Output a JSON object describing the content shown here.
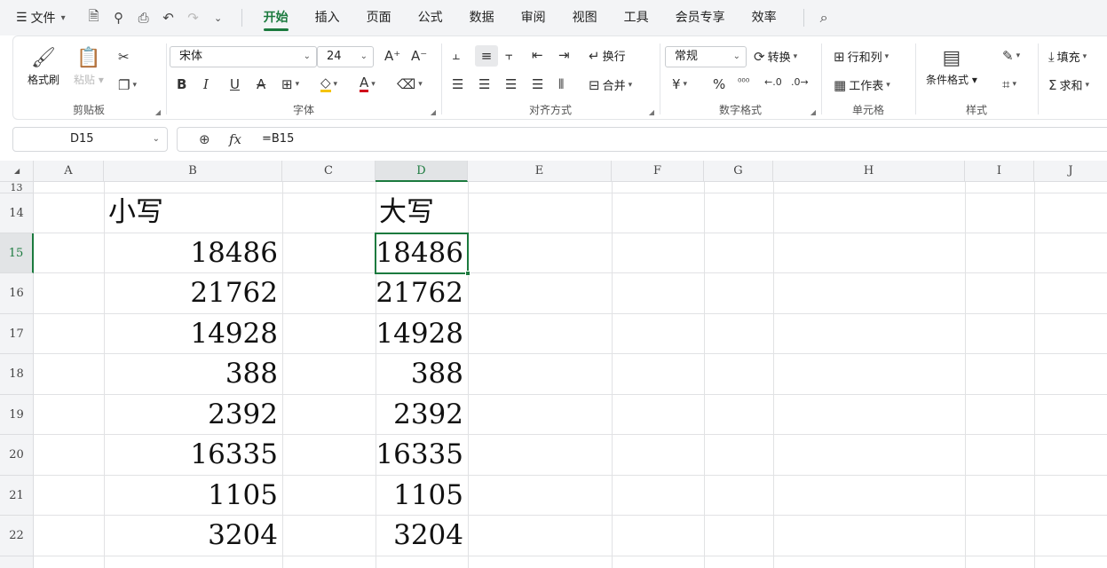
{
  "menubar": {
    "file_label": "文件",
    "tabs": [
      {
        "label": "开始",
        "active": true
      },
      {
        "label": "插入"
      },
      {
        "label": "页面"
      },
      {
        "label": "公式"
      },
      {
        "label": "数据"
      },
      {
        "label": "审阅"
      },
      {
        "label": "视图"
      },
      {
        "label": "工具"
      },
      {
        "label": "会员专享"
      },
      {
        "label": "效率"
      }
    ]
  },
  "ribbon": {
    "clipboard": {
      "label": "剪贴板",
      "format_painter": "格式刷",
      "paste": "粘贴"
    },
    "font": {
      "label": "字体",
      "font_name": "宋体",
      "font_size": "24"
    },
    "align": {
      "label": "对齐方式",
      "wrap": "换行",
      "merge": "合并"
    },
    "number": {
      "label": "数字格式",
      "format": "常规",
      "convert": "转换"
    },
    "cells": {
      "label": "单元格",
      "rows_cols": "行和列",
      "worksheet": "工作表"
    },
    "styles": {
      "label": "样式",
      "conditional": "条件格式"
    },
    "edit": {
      "fill": "填充",
      "sum": "求和"
    }
  },
  "formula_bar": {
    "cell_ref": "D15",
    "formula": "=B15"
  },
  "columns": [
    "A",
    "B",
    "C",
    "D",
    "E",
    "F",
    "G",
    "H",
    "I",
    "J"
  ],
  "selected_column": "D",
  "rows": [
    "13",
    "14",
    "15",
    "16",
    "17",
    "18",
    "19",
    "20",
    "21",
    "22"
  ],
  "selected_row": "15",
  "sheet": {
    "header_b": "小写",
    "header_d": "大写",
    "values_b": [
      "18486",
      "21762",
      "14928",
      "388",
      "2392",
      "16335",
      "1105",
      "3204"
    ],
    "values_d": [
      "18486",
      "21762",
      "14928",
      "388",
      "2392",
      "16335",
      "1105",
      "3204"
    ]
  },
  "colors": {
    "accent": "#1b7a3e",
    "header_bg": "#f3f4f6",
    "grid_line": "#e1e2e4"
  }
}
